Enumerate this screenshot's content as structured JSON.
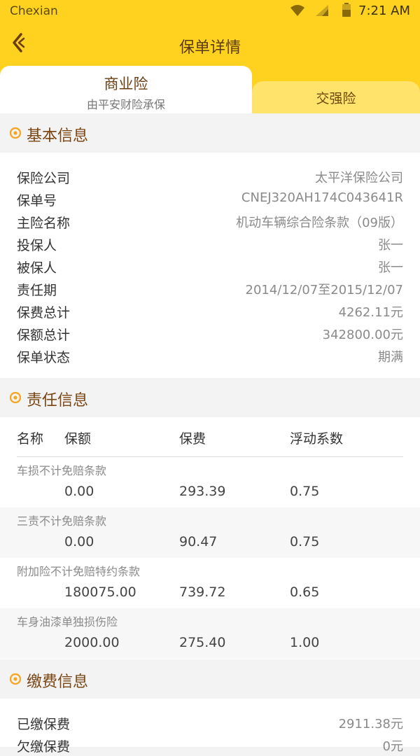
{
  "status_bar": {
    "carrier": "Chexian",
    "time": "7:21 AM",
    "icons": [
      "wifi-icon",
      "signal-icon",
      "battery-icon"
    ]
  },
  "header": {
    "title": "保单详情",
    "back_icon": "back-arrow-icon"
  },
  "tabs": {
    "active": {
      "label": "商业险",
      "sublabel": "由平安财险承保"
    },
    "inactive": {
      "label": "交强险"
    }
  },
  "sections": {
    "basic": {
      "title": "基本信息",
      "rows": [
        {
          "key": "保险公司",
          "value": "太平洋保险公司"
        },
        {
          "key": "保单号",
          "value": "CNEJ320AH174C043641R"
        },
        {
          "key": "主险名称",
          "value": "机动车辆综合险条款（09版）"
        },
        {
          "key": "投保人",
          "value": "张一"
        },
        {
          "key": "被保人",
          "value": "张一"
        },
        {
          "key": "责任期",
          "value": "2014/12/07至2015/12/07"
        },
        {
          "key": "保费总计",
          "value": "4262.11元"
        },
        {
          "key": "保额总计",
          "value": "342800.00元"
        },
        {
          "key": "保单状态",
          "value": "期满"
        }
      ]
    },
    "coverage": {
      "title": "责任信息",
      "headers": {
        "name": "名称",
        "amount": "保额",
        "fee": "保费",
        "coef": "浮动系数"
      },
      "rows": [
        {
          "name": "车损不计免赔条款",
          "amount": "0.00",
          "fee": "293.39",
          "coef": "0.75"
        },
        {
          "name": "三责不计免赔条款",
          "amount": "0.00",
          "fee": "90.47",
          "coef": "0.75"
        },
        {
          "name": "附加险不计免赔特约条款",
          "amount": "180075.00",
          "fee": "739.72",
          "coef": "0.65"
        },
        {
          "name": "车身油漆单独损伤险",
          "amount": "2000.00",
          "fee": "275.40",
          "coef": "1.00"
        }
      ]
    },
    "payment": {
      "title": "缴费信息",
      "rows": [
        {
          "key": "已缴保费",
          "value": "2911.38元"
        },
        {
          "key": "欠缴保费",
          "value": "0元"
        }
      ]
    }
  },
  "colors": {
    "brand_yellow": "#ffd21f",
    "tab_inactive": "#ffe36a",
    "section_title": "#7a4512",
    "section_icon": "#f5a623"
  }
}
